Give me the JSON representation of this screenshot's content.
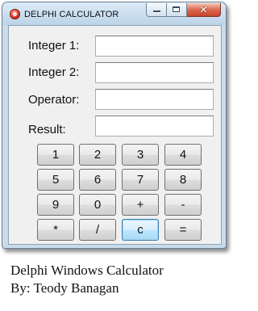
{
  "window": {
    "title": "DELPHI CALCULATOR",
    "close_glyph": "✕"
  },
  "form": {
    "integer1_label": "Integer 1:",
    "integer1_value": "",
    "integer2_label": "Integer 2:",
    "integer2_value": "",
    "operator_label": "Operator:",
    "operator_value": "",
    "result_label": "Result:",
    "result_value": ""
  },
  "keypad": {
    "rows": [
      [
        "1",
        "2",
        "3",
        "4"
      ],
      [
        "5",
        "6",
        "7",
        "8"
      ],
      [
        "9",
        "0",
        "+",
        "-"
      ],
      [
        "*",
        "/",
        "c",
        "="
      ]
    ],
    "focused_key": "c"
  },
  "caption": {
    "line1": "Delphi Windows Calculator",
    "line2": "By: Teody Banagan"
  },
  "colors": {
    "frame": "#c9dceb",
    "client": "#f0f0f0",
    "close_button": "#c8432a"
  }
}
